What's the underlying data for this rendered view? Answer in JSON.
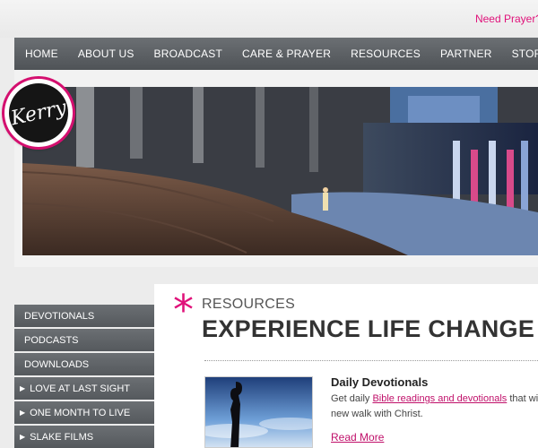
{
  "header": {
    "need_prayer": "Need Prayer?"
  },
  "nav": {
    "items": [
      "HOME",
      "ABOUT US",
      "BROADCAST",
      "CARE & PRAYER",
      "RESOURCES",
      "PARTNER",
      "STORE"
    ]
  },
  "logo": {
    "text": "Kerry"
  },
  "sidebar": {
    "items": [
      {
        "label": "DEVOTIONALS",
        "arrow": ""
      },
      {
        "label": "PODCASTS",
        "arrow": ""
      },
      {
        "label": "DOWNLOADS",
        "arrow": ""
      },
      {
        "label": "LOVE AT LAST SIGHT",
        "arrow": "▶"
      },
      {
        "label": "ONE MONTH TO LIVE",
        "arrow": "▶"
      },
      {
        "label": "SLAKE FILMS",
        "arrow": "▶"
      }
    ]
  },
  "main": {
    "kicker": "RESOURCES",
    "title": "EXPERIENCE LIFE CHANGE",
    "feature": {
      "title": "Daily Devotionals",
      "desc_prefix": "Get daily ",
      "desc_link": "Bible readings and devotionals",
      "desc_suffix": " that wil new walk with Christ.",
      "read_more": "Read More"
    }
  },
  "colors": {
    "accent": "#e0127a",
    "nav_bg": "#5d6165",
    "page_bg": "#ececec"
  }
}
